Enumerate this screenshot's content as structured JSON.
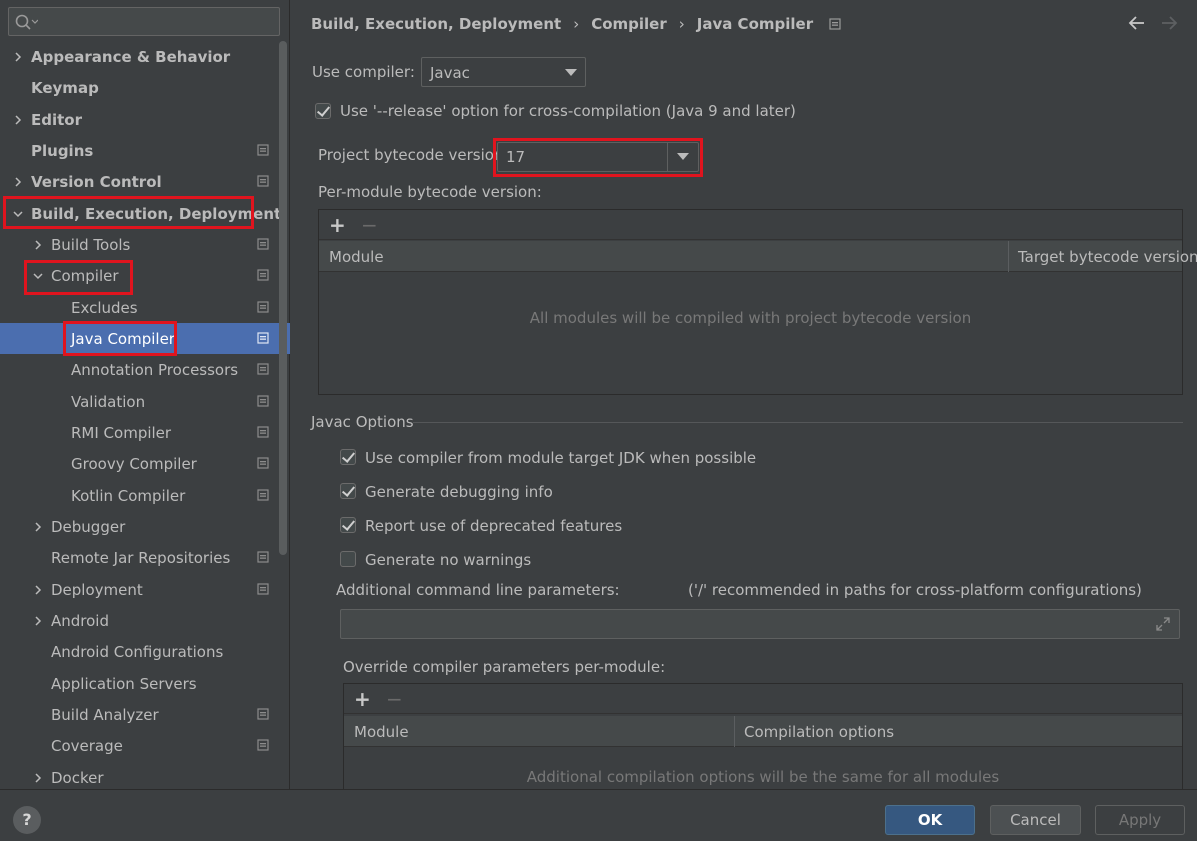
{
  "search": {
    "placeholder": ""
  },
  "sidebar": {
    "items": [
      {
        "label": "Appearance & Behavior",
        "expandable": true,
        "expanded": false,
        "bold": true,
        "project": false
      },
      {
        "label": "Keymap",
        "expandable": false,
        "bold": true,
        "project": false
      },
      {
        "label": "Editor",
        "expandable": true,
        "expanded": false,
        "bold": true,
        "project": false
      },
      {
        "label": "Plugins",
        "expandable": false,
        "bold": true,
        "project": true
      },
      {
        "label": "Version Control",
        "expandable": true,
        "expanded": false,
        "bold": true,
        "project": true
      },
      {
        "label": "Build, Execution, Deployment",
        "expandable": true,
        "expanded": true,
        "bold": true,
        "project": false
      },
      {
        "label": "Build Tools",
        "expandable": true,
        "expanded": false,
        "project": true
      },
      {
        "label": "Compiler",
        "expandable": true,
        "expanded": true,
        "project": true
      },
      {
        "label": "Excludes",
        "project": true
      },
      {
        "label": "Java Compiler",
        "project": true,
        "selected": true
      },
      {
        "label": "Annotation Processors",
        "project": true
      },
      {
        "label": "Validation",
        "project": true
      },
      {
        "label": "RMI Compiler",
        "project": true
      },
      {
        "label": "Groovy Compiler",
        "project": true
      },
      {
        "label": "Kotlin Compiler",
        "project": true
      },
      {
        "label": "Debugger",
        "expandable": true,
        "expanded": false,
        "project": false
      },
      {
        "label": "Remote Jar Repositories",
        "project": true
      },
      {
        "label": "Deployment",
        "expandable": true,
        "expanded": false,
        "project": true
      },
      {
        "label": "Android",
        "expandable": true,
        "expanded": false,
        "project": false
      },
      {
        "label": "Android Configurations",
        "project": false
      },
      {
        "label": "Application Servers",
        "project": false
      },
      {
        "label": "Build Analyzer",
        "project": true
      },
      {
        "label": "Coverage",
        "project": true
      },
      {
        "label": "Docker",
        "expandable": true,
        "expanded": false,
        "project": false
      }
    ]
  },
  "breadcrumb": {
    "items": [
      "Build, Execution, Deployment",
      "Compiler",
      "Java Compiler"
    ]
  },
  "form": {
    "use_compiler_label": "Use compiler:",
    "use_compiler_value": "Javac",
    "release_option_label": "Use '--release' option for cross-compilation (Java 9 and later)",
    "release_option_checked": true,
    "bytecode_label": "Project bytecode version:",
    "bytecode_value": "17",
    "per_module_label": "Per-module bytecode version:",
    "per_module_table": {
      "columns": [
        "Module",
        "Target bytecode version"
      ],
      "empty_text": "All modules will be compiled with project bytecode version"
    },
    "javac_group_title": "Javac Options",
    "javac_options": [
      {
        "label": "Use compiler from module target JDK when possible",
        "checked": true
      },
      {
        "label": "Generate debugging info",
        "checked": true
      },
      {
        "label": "Report use of deprecated features",
        "checked": true
      },
      {
        "label": "Generate no warnings",
        "checked": false
      }
    ],
    "additional_params_label": "Additional command line parameters:",
    "additional_params_hint": "('/' recommended in paths for cross-platform configurations)",
    "additional_params_value": "",
    "override_label": "Override compiler parameters per-module:",
    "override_table": {
      "columns": [
        "Module",
        "Compilation options"
      ],
      "empty_text": "Additional compilation options will be the same for all modules"
    }
  },
  "buttons": {
    "help": "?",
    "ok": "OK",
    "cancel": "Cancel",
    "apply": "Apply"
  },
  "toolbar": {
    "add": "+",
    "remove": "−"
  },
  "colors": {
    "background": "#3c3f41",
    "selection": "#4b6eaf",
    "highlight": "#e0141e",
    "ok_button": "#365880"
  }
}
